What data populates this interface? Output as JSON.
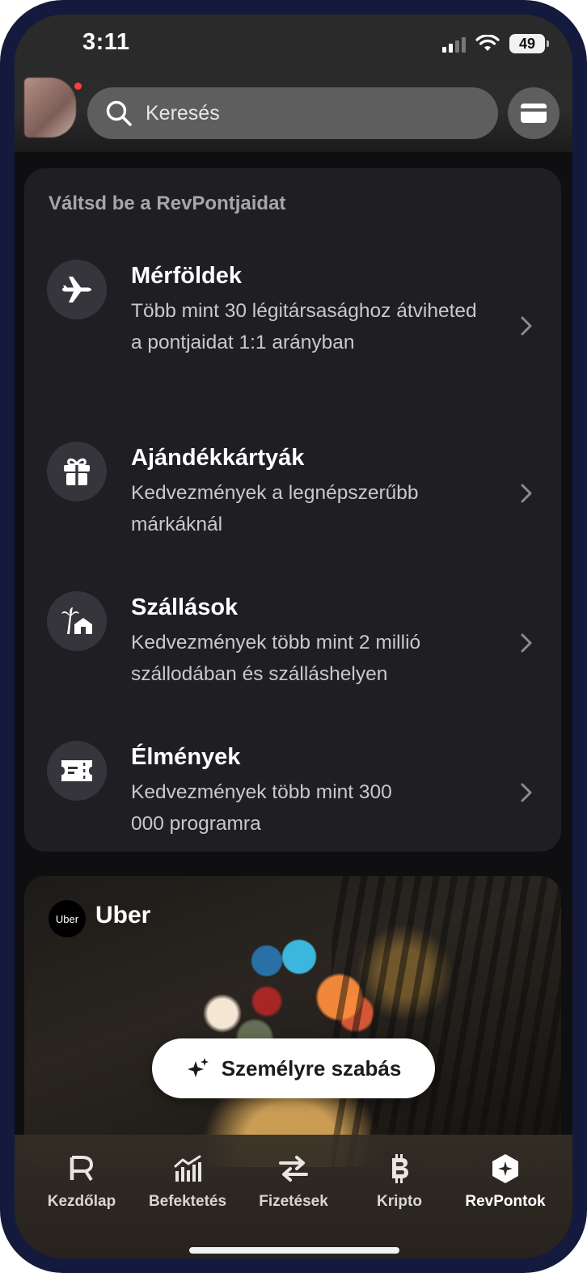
{
  "status_bar": {
    "time": "3:11",
    "battery": "49"
  },
  "header": {
    "search_placeholder": "Keresés"
  },
  "rewards": {
    "section_title": "Váltsd be a RevPontjaidat",
    "items": [
      {
        "title": "Mérföldek",
        "description": "Több mint 30 légitársasághoz átviheted a pontjaidat 1:1 arányban",
        "icon": "airplane-icon"
      },
      {
        "title": "Ajándékkártyák",
        "description": "Kedvezmények a legnépszerűbb márkáknál",
        "icon": "gift-icon"
      },
      {
        "title": "Szállások",
        "description": "Kedvezmények több mint 2 millió szállodában és szálláshelyen",
        "icon": "palm-house-icon"
      },
      {
        "title": "Élmények",
        "description": "Kedvezmények több mint 300 000 programra",
        "icon": "ticket-icon"
      }
    ]
  },
  "promo": {
    "brand_logo_text": "Uber",
    "brand_name": "Uber"
  },
  "customize_button": {
    "label": "Személyre szabás"
  },
  "tabbar": {
    "tabs": [
      {
        "label": "Kezdőlap",
        "icon": "revolut-r-icon"
      },
      {
        "label": "Befektetés",
        "icon": "chart-bars-icon"
      },
      {
        "label": "Fizetések",
        "icon": "transfer-arrows-icon"
      },
      {
        "label": "Kripto",
        "icon": "bitcoin-icon"
      },
      {
        "label": "RevPontok",
        "icon": "revpoints-hexagon-icon",
        "active": true
      }
    ]
  }
}
